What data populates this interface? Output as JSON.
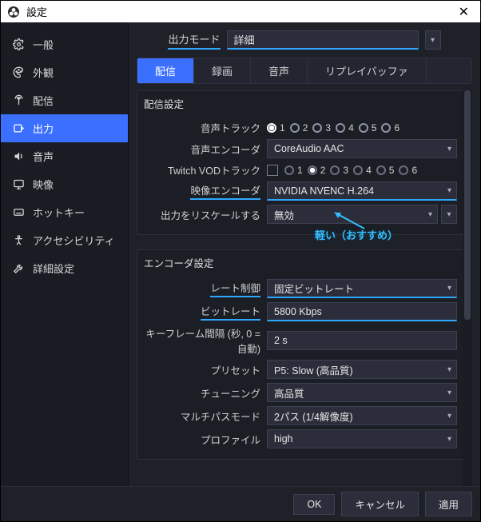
{
  "window": {
    "title": "設定"
  },
  "sidebar": {
    "items": [
      {
        "id": "general",
        "label": "一般"
      },
      {
        "id": "appearance",
        "label": "外観"
      },
      {
        "id": "stream",
        "label": "配信"
      },
      {
        "id": "output",
        "label": "出力"
      },
      {
        "id": "audio",
        "label": "音声"
      },
      {
        "id": "video",
        "label": "映像"
      },
      {
        "id": "hotkeys",
        "label": "ホットキー"
      },
      {
        "id": "accessibility",
        "label": "アクセシビリティ"
      },
      {
        "id": "advanced",
        "label": "詳細設定"
      }
    ]
  },
  "output_mode": {
    "label": "出力モード",
    "value": "詳細"
  },
  "tabs": [
    {
      "id": "streaming",
      "label": "配信"
    },
    {
      "id": "recording",
      "label": "録画"
    },
    {
      "id": "audio",
      "label": "音声"
    },
    {
      "id": "replay",
      "label": "リプレイバッファ"
    }
  ],
  "stream_group": {
    "title": "配信設定",
    "audio_track": {
      "label": "音声トラック",
      "options": [
        "1",
        "2",
        "3",
        "4",
        "5",
        "6"
      ],
      "selected": 0
    },
    "audio_encoder": {
      "label": "音声エンコーダ",
      "value": "CoreAudio AAC"
    },
    "twitch_vod": {
      "label": "Twitch VODトラック",
      "checked": false,
      "options": [
        "1",
        "2",
        "3",
        "4",
        "5",
        "6"
      ],
      "selected": 1
    },
    "video_encoder": {
      "label": "映像エンコーダ",
      "value": "NVIDIA NVENC H.264"
    },
    "rescale": {
      "label": "出力をリスケールする",
      "value": "無効"
    }
  },
  "annotation": {
    "text": "軽い（おすすめ）"
  },
  "encoder_group": {
    "title": "エンコーダ設定",
    "rate_control": {
      "label": "レート制御",
      "value": "固定ビットレート"
    },
    "bitrate": {
      "label": "ビットレート",
      "value": "5800 Kbps"
    },
    "keyframe": {
      "label": "キーフレーム間隔 (秒, 0 = 自動)",
      "value": "2 s"
    },
    "preset": {
      "label": "プリセット",
      "value": "P5: Slow (高品質)"
    },
    "tuning": {
      "label": "チューニング",
      "value": "高品質"
    },
    "multipass": {
      "label": "マルチパスモード",
      "value": "2パス (1/4解像度)"
    },
    "profile": {
      "label": "プロファイル",
      "value": "high"
    }
  },
  "footer": {
    "ok": "OK",
    "cancel": "キャンセル",
    "apply": "適用"
  }
}
